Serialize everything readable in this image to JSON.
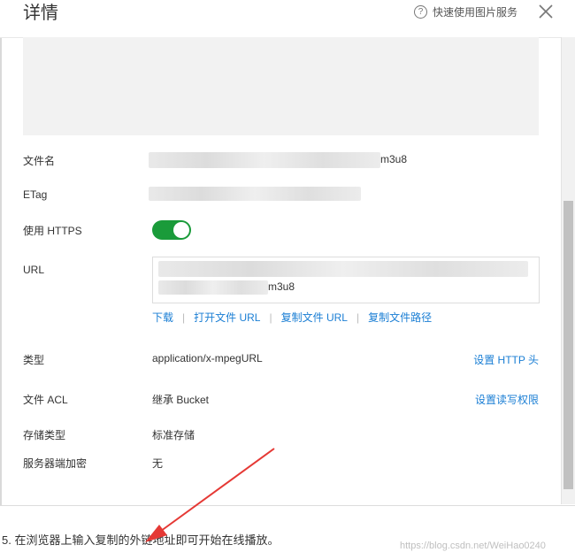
{
  "dialog": {
    "title": "详情",
    "help_label": "快速使用图片服务"
  },
  "details": {
    "filename_label": "文件名",
    "filename_suffix": "m3u8",
    "etag_label": "ETag",
    "https_label": "使用 HTTPS",
    "https_enabled": true,
    "url_label": "URL",
    "url_suffix": "m3u8",
    "actions": [
      "下载",
      "打开文件 URL",
      "复制文件 URL",
      "复制文件路径"
    ],
    "type_label": "类型",
    "type_value": "application/x-mpegURL",
    "type_action": "设置 HTTP 头",
    "acl_label": "文件 ACL",
    "acl_value": "继承 Bucket",
    "acl_action": "设置读写权限",
    "storage_label": "存储类型",
    "storage_value": "标准存储",
    "encryption_label": "服务器端加密",
    "encryption_value": "无"
  },
  "caption": "5. 在浏览器上输入复制的外链地址即可开始在线播放。",
  "watermark": "https://blog.csdn.net/WeiHao0240",
  "colors": {
    "toggle_on": "#1a9b3a",
    "link": "#1a7ed4",
    "annotation_arrow": "#e53935"
  }
}
